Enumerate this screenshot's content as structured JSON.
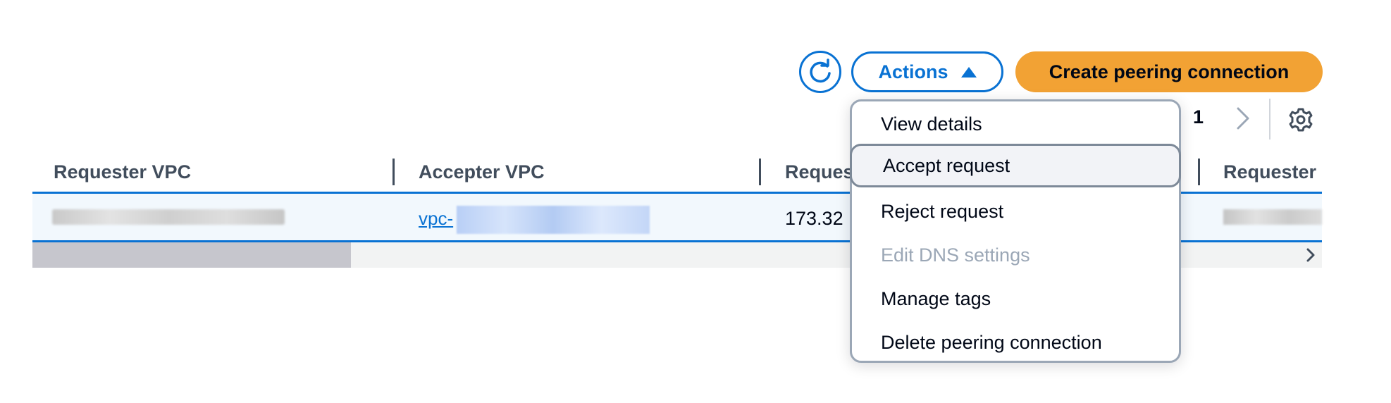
{
  "toolbar": {
    "refresh_icon": "refresh-icon",
    "actions_label": "Actions",
    "create_label": "Create peering connection",
    "accent_color": "#0972d3",
    "primary_color": "#f2a234"
  },
  "pagination": {
    "current_page": "1"
  },
  "table": {
    "headers": [
      "Requester VPC",
      "Accepter VPC",
      "Reques",
      "Requester"
    ],
    "row": {
      "requester_vpc": "",
      "accepter_vpc_prefix": "vpc-",
      "requester_cidr": "173.32"
    }
  },
  "actions_menu": {
    "items": [
      {
        "label": "View details",
        "disabled": false
      },
      {
        "label": "Accept request",
        "disabled": false
      },
      {
        "label": "Reject request",
        "disabled": false
      },
      {
        "label": "Edit DNS settings",
        "disabled": true
      },
      {
        "label": "Manage tags",
        "disabled": false
      },
      {
        "label": "Delete peering connection",
        "disabled": false
      }
    ],
    "hovered_item": "Accept request"
  }
}
